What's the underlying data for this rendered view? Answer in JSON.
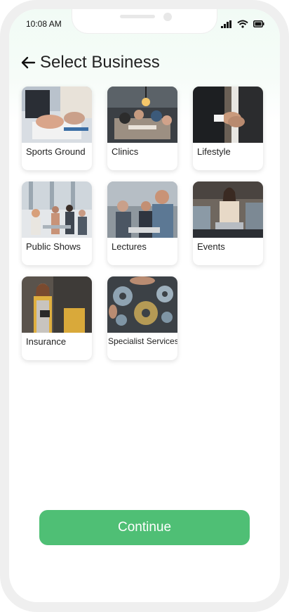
{
  "status_bar": {
    "time": "10:08 AM"
  },
  "header": {
    "title": "Select Business"
  },
  "businesses": [
    {
      "label": "Sports Ground",
      "image": "business-handshake-meeting-photo"
    },
    {
      "label": "Clinics",
      "image": "team-meeting-table-photo"
    },
    {
      "label": "Lifestyle",
      "image": "handshake-suits-photo"
    },
    {
      "label": "Public Shows",
      "image": "office-group-presentation-photo"
    },
    {
      "label": "Lectures",
      "image": "coworkers-discussion-photo"
    },
    {
      "label": "Events",
      "image": "woman-laptop-cafe-photo"
    },
    {
      "label": "Insurance",
      "image": "woman-apron-tablet-photo"
    },
    {
      "label": "Specialist Services",
      "image": "gears-teamwork-photo"
    }
  ],
  "footer": {
    "continue_label": "Continue"
  },
  "colors": {
    "accent": "#4fbf75",
    "tint": "#f1fbf5"
  }
}
